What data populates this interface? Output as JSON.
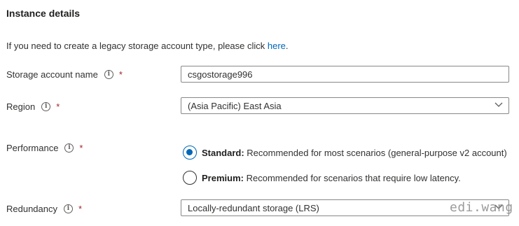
{
  "section": {
    "title": "Instance details",
    "intro_text": "If you need to create a legacy storage account type, please click ",
    "intro_link": "here",
    "intro_end": "."
  },
  "fields": {
    "storage_account_name": {
      "label": "Storage account name",
      "value": "csgostorage996"
    },
    "region": {
      "label": "Region",
      "value": "(Asia Pacific) East Asia"
    },
    "performance": {
      "label": "Performance",
      "options": [
        {
          "title": "Standard:",
          "description": "Recommended for most scenarios (general-purpose v2 account)",
          "selected": true
        },
        {
          "title": "Premium:",
          "description": "Recommended for scenarios that require low latency.",
          "selected": false
        }
      ]
    },
    "redundancy": {
      "label": "Redundancy",
      "value": "Locally-redundant storage (LRS)"
    }
  },
  "common": {
    "required_mark": "*",
    "info_glyph": "i"
  },
  "watermark": "edi.wang",
  "icons": {
    "info": "info-circle-icon",
    "dropdown": "chevron-down-icon",
    "radio": "radio-icon"
  },
  "colors": {
    "accent": "#0067b8",
    "required": "#a4262c",
    "border": "#8a8886"
  }
}
